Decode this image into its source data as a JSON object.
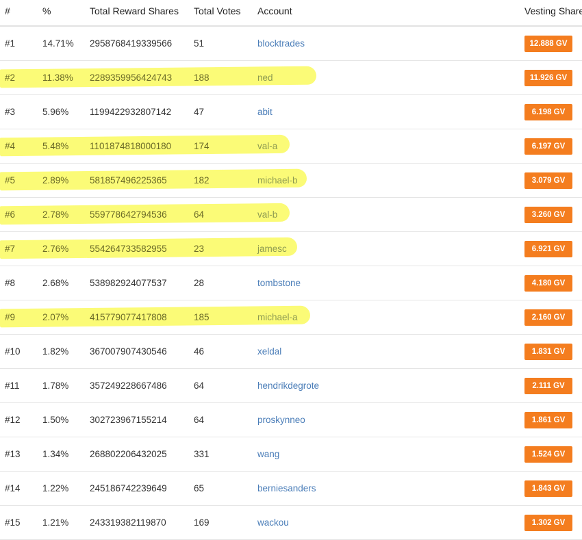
{
  "columns": {
    "rank": "#",
    "percent": "%",
    "reward_shares": "Total Reward Shares",
    "votes": "Total Votes",
    "account": "Account",
    "vesting": "Vesting Share"
  },
  "rows": [
    {
      "rank": "#1",
      "percent": "14.71%",
      "shares": "2958768419339566",
      "votes": "51",
      "account": "blocktrades",
      "vesting": "12.888 GV",
      "highlighted": false
    },
    {
      "rank": "#2",
      "percent": "11.38%",
      "shares": "2289359956424743",
      "votes": "188",
      "account": "ned",
      "vesting": "11.926 GV",
      "highlighted": true
    },
    {
      "rank": "#3",
      "percent": "5.96%",
      "shares": "1199422932807142",
      "votes": "47",
      "account": "abit",
      "vesting": "6.198 GV",
      "highlighted": false
    },
    {
      "rank": "#4",
      "percent": "5.48%",
      "shares": "1101874818000180",
      "votes": "174",
      "account": "val-a",
      "vesting": "6.197 GV",
      "highlighted": true
    },
    {
      "rank": "#5",
      "percent": "2.89%",
      "shares": "581857496225365",
      "votes": "182",
      "account": "michael-b",
      "vesting": "3.079 GV",
      "highlighted": true
    },
    {
      "rank": "#6",
      "percent": "2.78%",
      "shares": "559778642794536",
      "votes": "64",
      "account": "val-b",
      "vesting": "3.260 GV",
      "highlighted": true
    },
    {
      "rank": "#7",
      "percent": "2.76%",
      "shares": "554264733582955",
      "votes": "23",
      "account": "jamesc",
      "vesting": "6.921 GV",
      "highlighted": true
    },
    {
      "rank": "#8",
      "percent": "2.68%",
      "shares": "538982924077537",
      "votes": "28",
      "account": "tombstone",
      "vesting": "4.180 GV",
      "highlighted": false
    },
    {
      "rank": "#9",
      "percent": "2.07%",
      "shares": "415779077417808",
      "votes": "185",
      "account": "michael-a",
      "vesting": "2.160 GV",
      "highlighted": true
    },
    {
      "rank": "#10",
      "percent": "1.82%",
      "shares": "367007907430546",
      "votes": "46",
      "account": "xeldal",
      "vesting": "1.831 GV",
      "highlighted": false
    },
    {
      "rank": "#11",
      "percent": "1.78%",
      "shares": "357249228667486",
      "votes": "64",
      "account": "hendrikdegrote",
      "vesting": "2.111 GV",
      "highlighted": false
    },
    {
      "rank": "#12",
      "percent": "1.50%",
      "shares": "302723967155214",
      "votes": "64",
      "account": "proskynneo",
      "vesting": "1.861 GV",
      "highlighted": false
    },
    {
      "rank": "#13",
      "percent": "1.34%",
      "shares": "268802206432025",
      "votes": "331",
      "account": "wang",
      "vesting": "1.524 GV",
      "highlighted": false
    },
    {
      "rank": "#14",
      "percent": "1.22%",
      "shares": "245186742239649",
      "votes": "65",
      "account": "berniesanders",
      "vesting": "1.843 GV",
      "highlighted": false
    },
    {
      "rank": "#15",
      "percent": "1.21%",
      "shares": "243319382119870",
      "votes": "169",
      "account": "wackou",
      "vesting": "1.302 GV",
      "highlighted": false
    }
  ],
  "colors": {
    "badge": "#f47d1f",
    "link": "#4a7db8",
    "highlight": "#fbfb64"
  }
}
